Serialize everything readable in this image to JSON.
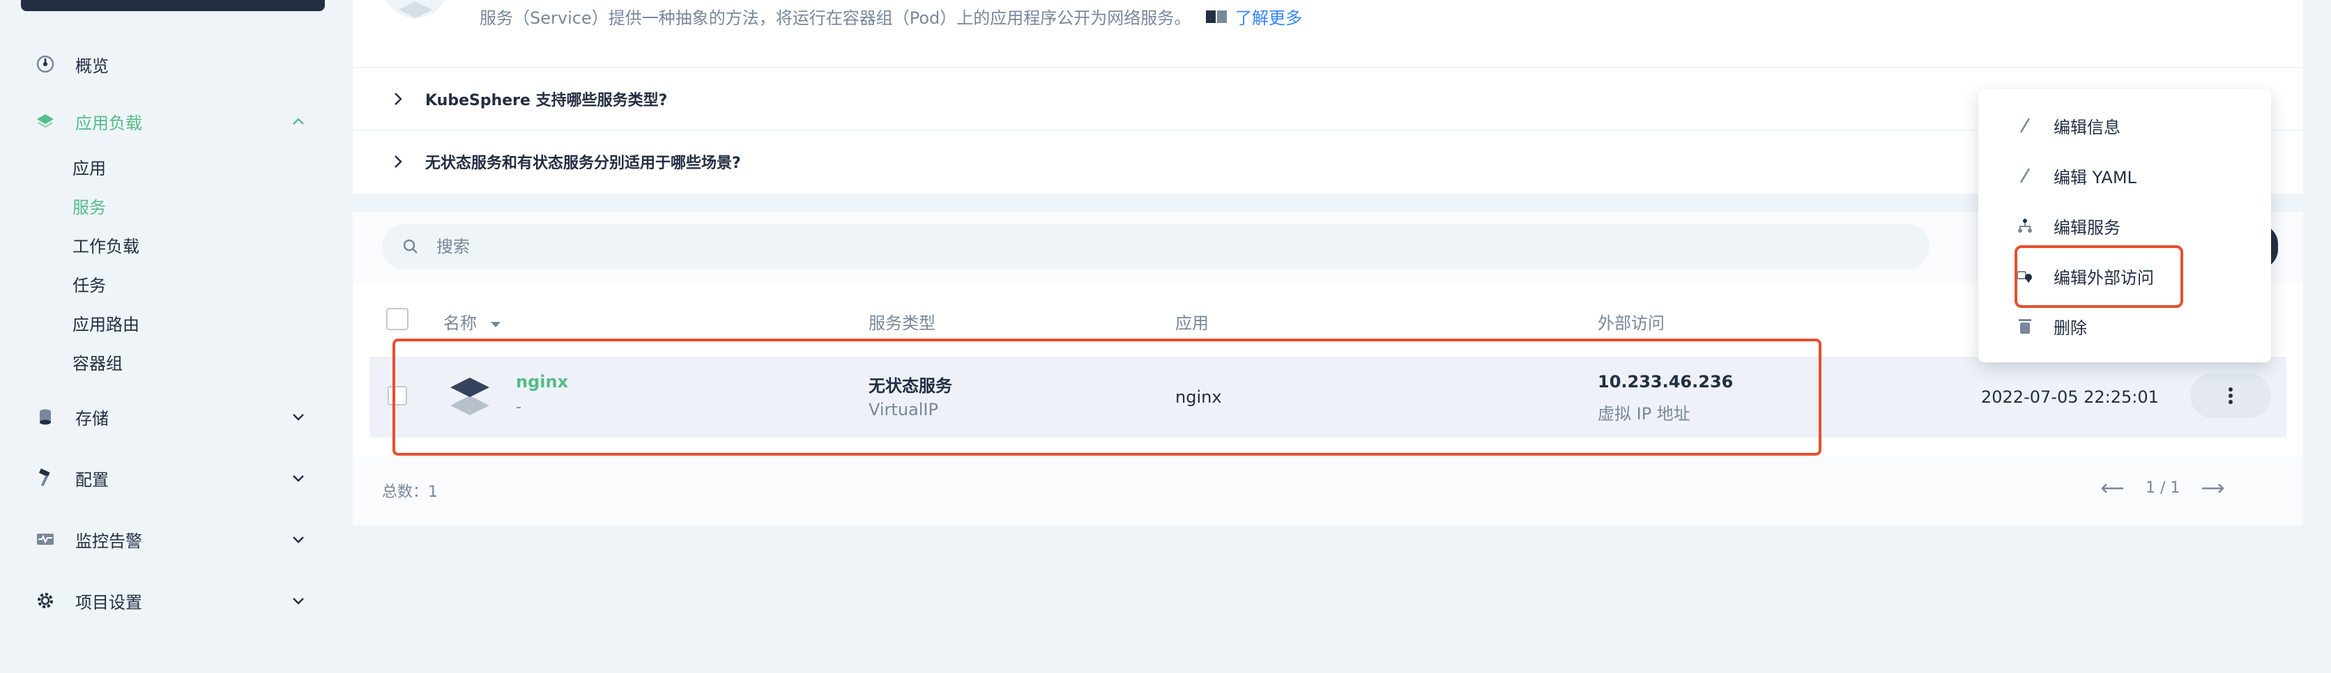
{
  "sidebar": {
    "items": [
      {
        "label": "概览",
        "icon": "gauge-icon"
      },
      {
        "label": "应用负载",
        "icon": "layers-icon",
        "expanded": true
      },
      {
        "label": "存储",
        "icon": "database-icon"
      },
      {
        "label": "配置",
        "icon": "hammer-icon"
      },
      {
        "label": "监控告警",
        "icon": "monitor-pulse-icon"
      },
      {
        "label": "项目设置",
        "icon": "gear-icon"
      }
    ],
    "subitems": [
      {
        "label": "应用"
      },
      {
        "label": "服务",
        "active": true
      },
      {
        "label": "工作负载"
      },
      {
        "label": "任务"
      },
      {
        "label": "应用路由"
      },
      {
        "label": "容器组"
      }
    ]
  },
  "banner": {
    "description": "服务（Service）提供一种抽象的方法，将运行在容器组（Pod）上的应用程序公开为网络服务。",
    "learn_more": "了解更多"
  },
  "faq": [
    {
      "question": "KubeSphere 支持哪些服务类型?"
    },
    {
      "question": "无状态服务和有状态服务分别适用于哪些场景?"
    }
  ],
  "search": {
    "placeholder": "搜索"
  },
  "table": {
    "headers": {
      "name": "名称",
      "type": "服务类型",
      "app": "应用",
      "external": "外部访问"
    },
    "rows": [
      {
        "name": "nginx",
        "name_sub": "-",
        "type": "无状态服务",
        "type_sub": "VirtualIP",
        "app": "nginx",
        "external_ip": "10.233.46.236",
        "external_sub": "虚拟 IP 地址",
        "created": "2022-07-05 22:25:01"
      }
    ],
    "total_label": "总数：1",
    "pager": "1 / 1"
  },
  "menu": {
    "items": [
      {
        "label": "编辑信息",
        "icon": "pen-icon"
      },
      {
        "label": "编辑 YAML",
        "icon": "pen-icon"
      },
      {
        "label": "编辑服务",
        "icon": "network-icon"
      },
      {
        "label": "编辑外部访问",
        "icon": "external-access-icon"
      },
      {
        "label": "删除",
        "icon": "trash-icon"
      }
    ]
  },
  "colors": {
    "accent": "#55bc8a",
    "dark": "#242e42",
    "highlight": "#e5502f",
    "link": "#3385ff"
  }
}
